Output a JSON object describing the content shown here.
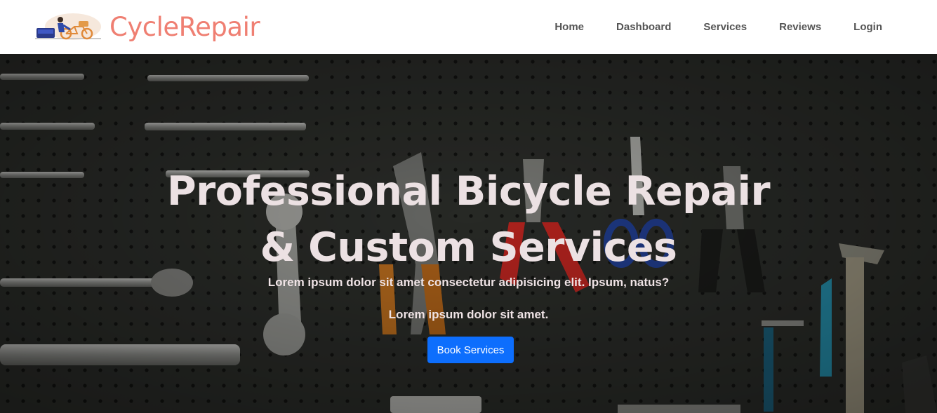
{
  "brand": {
    "name": "CycleRepair",
    "logo_icon": "bicycle-repair-logo-icon",
    "color": "#ef7f72"
  },
  "nav": {
    "items": [
      {
        "label": "Home"
      },
      {
        "label": "Dashboard"
      },
      {
        "label": "Services"
      },
      {
        "label": "Reviews"
      },
      {
        "label": "Login"
      }
    ]
  },
  "hero": {
    "title_line1": "Professional Bicycle Repair",
    "title_line2": "& Custom Services",
    "subtitle1": "Lorem ipsum dolor sit amet consectetur adipisicing elit. Ipsum, natus?",
    "subtitle2": "Lorem ipsum dolor sit amet.",
    "cta_label": "Book Services",
    "cta_color": "#0d6efd",
    "background": "bicycle tools hanging on pegboard"
  }
}
